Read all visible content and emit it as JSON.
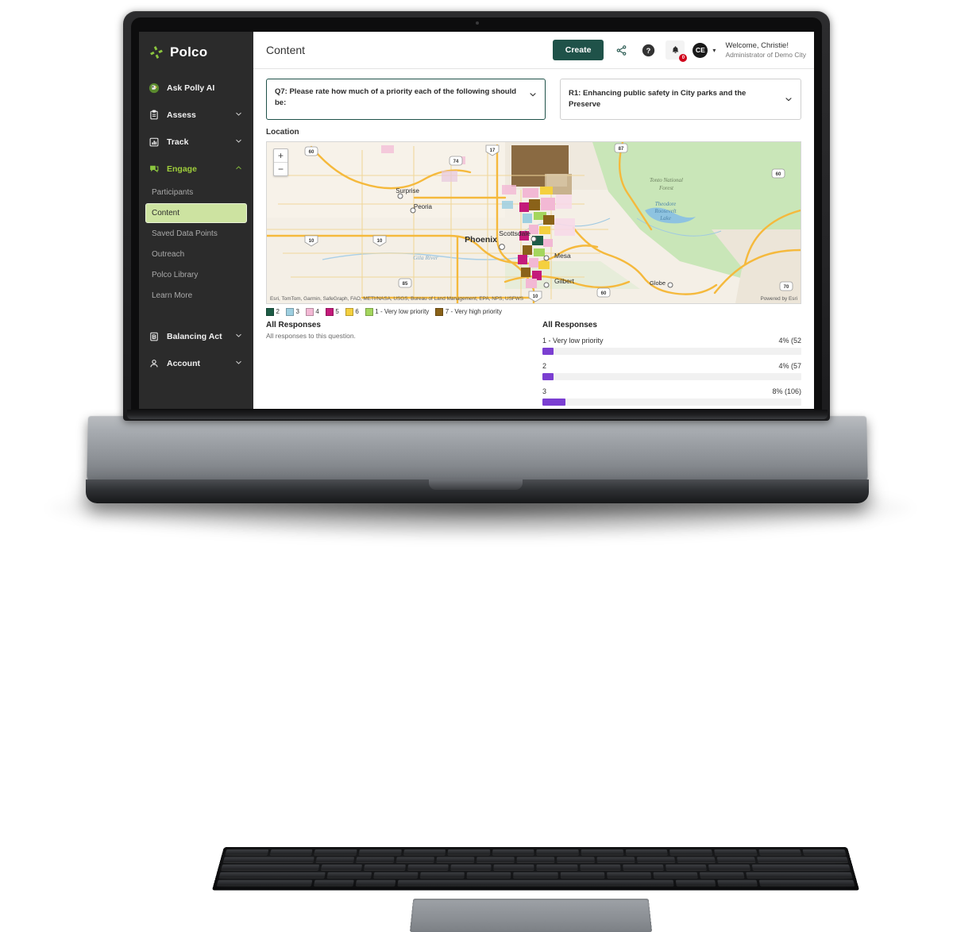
{
  "brand": {
    "name": "Polco"
  },
  "sidebar": {
    "items": [
      {
        "label": "Ask Polly AI",
        "icon": "polly-parrot-icon",
        "chevron": ""
      },
      {
        "label": "Assess",
        "icon": "clipboard-icon",
        "chevron": "⌄"
      },
      {
        "label": "Track",
        "icon": "chart-bars-icon",
        "chevron": "⌄"
      },
      {
        "label": "Engage",
        "icon": "chat-bubble-icon",
        "chevron": "⌃"
      }
    ],
    "sub_items": [
      {
        "label": "Participants",
        "active": false
      },
      {
        "label": "Content",
        "active": true
      },
      {
        "label": "Saved Data Points",
        "active": false
      },
      {
        "label": "Outreach",
        "active": false
      },
      {
        "label": "Polco Library",
        "active": false
      },
      {
        "label": "Learn More",
        "active": false
      }
    ],
    "lower_items": [
      {
        "label": "Balancing Act",
        "icon": "balancing-act-icon",
        "chevron": "⌄"
      },
      {
        "label": "Account",
        "icon": "person-icon",
        "chevron": "⌄"
      }
    ]
  },
  "header": {
    "title": "Content",
    "create_label": "Create",
    "share_icon": "share-icon",
    "help_icon": "question-mark-icon",
    "bell_icon": "bell-icon",
    "bell_badge": "0",
    "avatar_initials": "CE",
    "avatar_chevron": "▾",
    "welcome_line": "Welcome, Christie!",
    "role_line": "Administrator of Demo City"
  },
  "filters": {
    "question": "Q7: Please rate how much of a priority each of the following should be:",
    "response": "R1: Enhancing public safety in City parks and the Preserve",
    "chevron": "⌄"
  },
  "map_section": {
    "label": "Location",
    "zoom_in": "+",
    "zoom_out": "−",
    "attribution": "Esri, TomTom, Garmin, SafeGraph, FAO, METI/NASA, USGS, Bureau of Land Management, EPA, NPS, USFWS",
    "powered_by": "Powered by Esri",
    "city_labels": [
      "Surprise",
      "Peoria",
      "Phoenix",
      "Scottsdale",
      "Mesa",
      "Gilbert",
      "Globe"
    ],
    "area_labels": [
      "Tonto National Forest",
      "Theodore Roosevelt Lake",
      "Gila River"
    ],
    "highway_shields": [
      "60",
      "74",
      "17",
      "10",
      "10",
      "10",
      "87",
      "60",
      "60",
      "70",
      "85"
    ],
    "legend": [
      {
        "label": "2",
        "color": "#1d5c46"
      },
      {
        "label": "3",
        "color": "#9ecfe0"
      },
      {
        "label": "4",
        "color": "#f2b8d4"
      },
      {
        "label": "5",
        "color": "#c41a7a"
      },
      {
        "label": "6",
        "color": "#f4d03f"
      },
      {
        "label": "1 - Very low priority",
        "color": "#a4d65e"
      },
      {
        "label": "7 - Very high priority",
        "color": "#8a6219"
      }
    ]
  },
  "left_panel": {
    "title": "All Responses",
    "subtitle": "All responses to this question."
  },
  "chart_data": {
    "type": "bar",
    "title": "All Responses",
    "orientation": "horizontal",
    "xlabel": "",
    "ylabel": "",
    "bar_color": "#7b3fd1",
    "track_color": "#f1f1f1",
    "categories": [
      "1 - Very low priority",
      "2",
      "3"
    ],
    "values": [
      4,
      4,
      8
    ],
    "counts": [
      52,
      57,
      106
    ],
    "value_labels": [
      "4% (52",
      "4% (57",
      "8% (106)"
    ],
    "fill_widths": [
      "4.4%",
      "4.4%",
      "8.8%"
    ]
  }
}
